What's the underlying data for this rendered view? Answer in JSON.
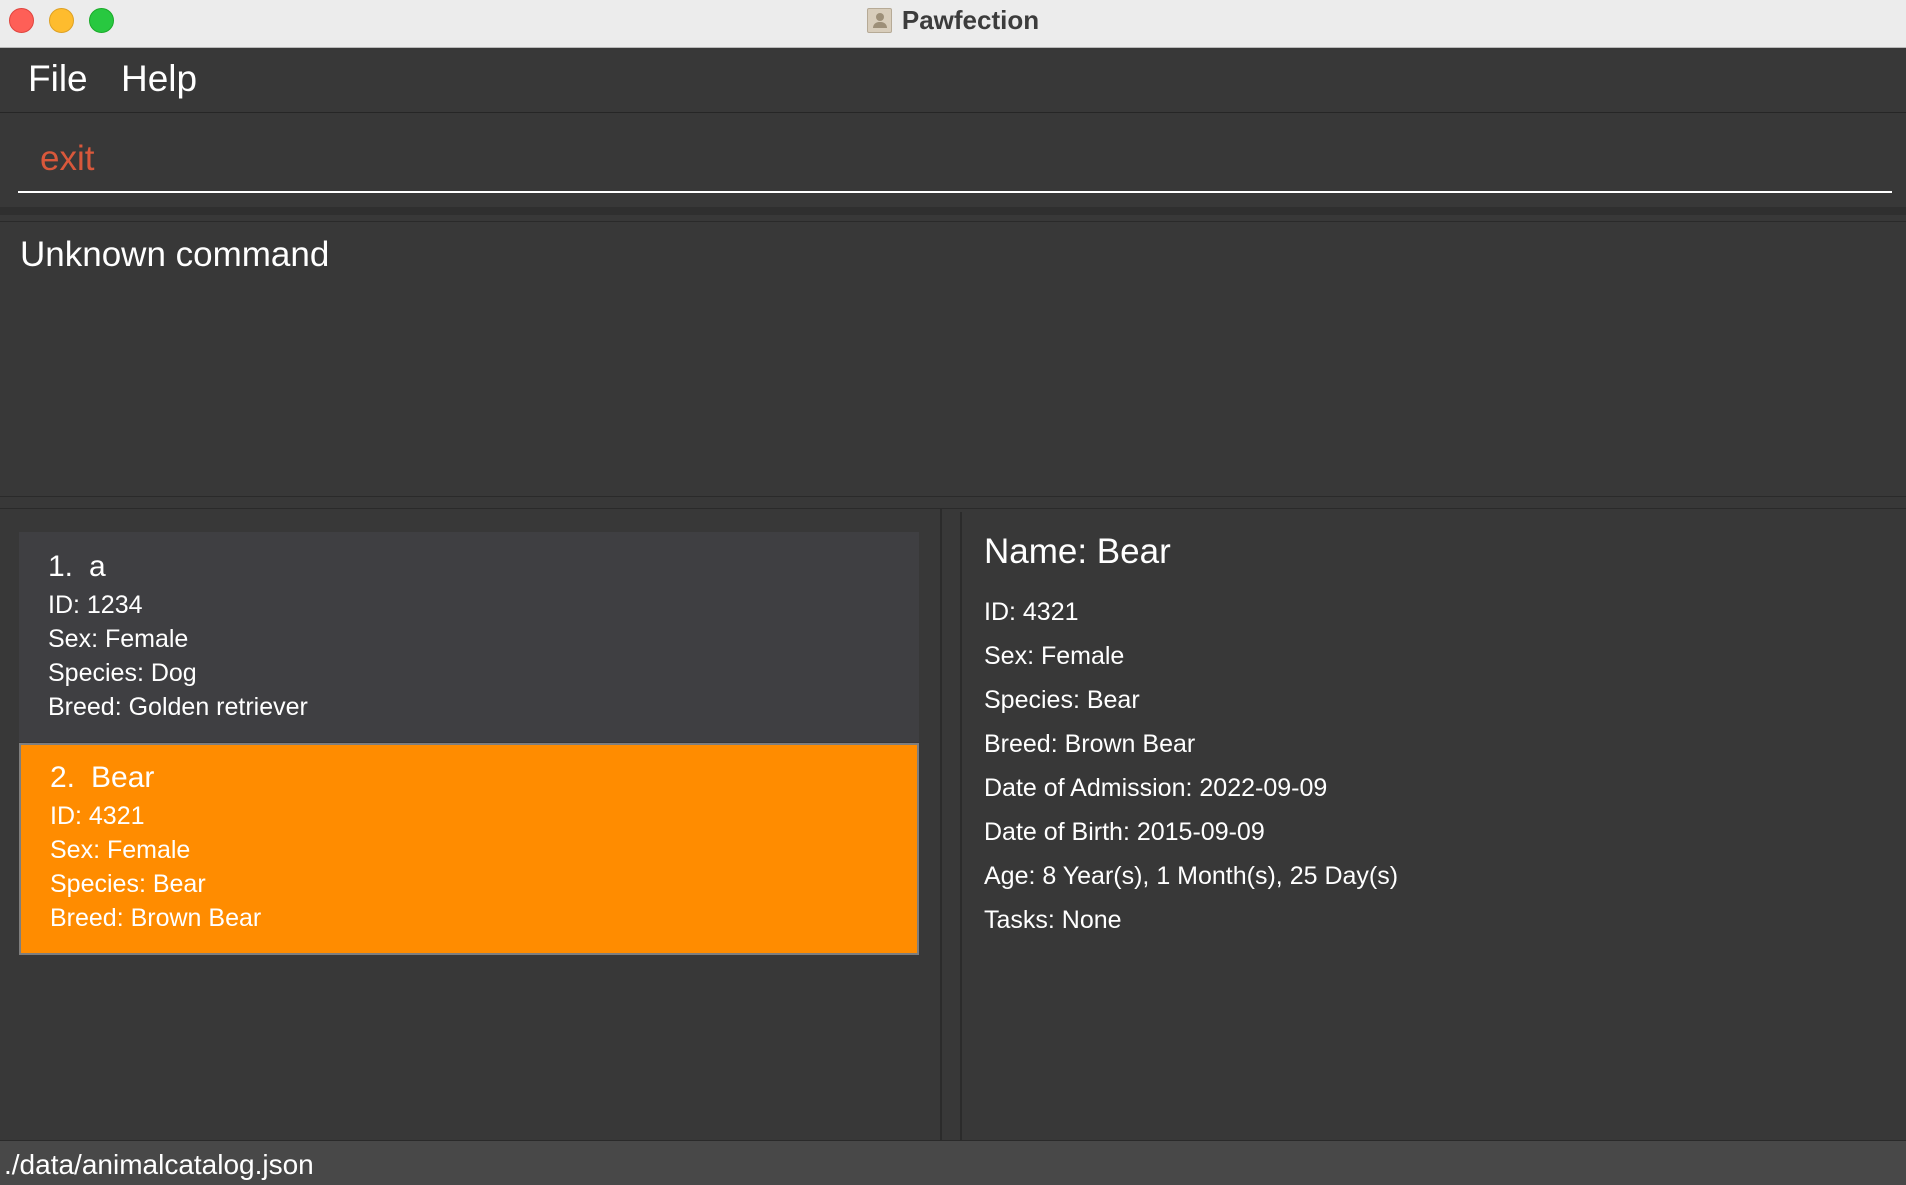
{
  "window": {
    "title": "Pawfection"
  },
  "menu": {
    "items": [
      "File",
      "Help"
    ]
  },
  "command": {
    "value": "exit"
  },
  "result": {
    "text": "Unknown command"
  },
  "animals": [
    {
      "index": "1.",
      "name": "a",
      "id": "ID: 1234",
      "sex": "Sex: Female",
      "species": "Species: Dog",
      "breed": "Breed: Golden retriever"
    },
    {
      "index": "2.",
      "name": "Bear",
      "id": "ID: 4321",
      "sex": "Sex: Female",
      "species": "Species: Bear",
      "breed": "Breed: Brown Bear"
    }
  ],
  "detail": {
    "name": "Name: Bear",
    "id": "ID: 4321",
    "sex": "Sex: Female",
    "species": "Species: Bear",
    "breed": "Breed: Brown Bear",
    "admission": "Date of Admission: 2022-09-09",
    "birth": "Date of Birth: 2015-09-09",
    "age": "Age: 8 Year(s), 1 Month(s), 25 Day(s)",
    "tasks": "Tasks: None"
  },
  "status": {
    "file_path": "./data/animalcatalog.json"
  },
  "colors": {
    "selected_card": "#ff8c00",
    "command_text": "#d9583b"
  }
}
